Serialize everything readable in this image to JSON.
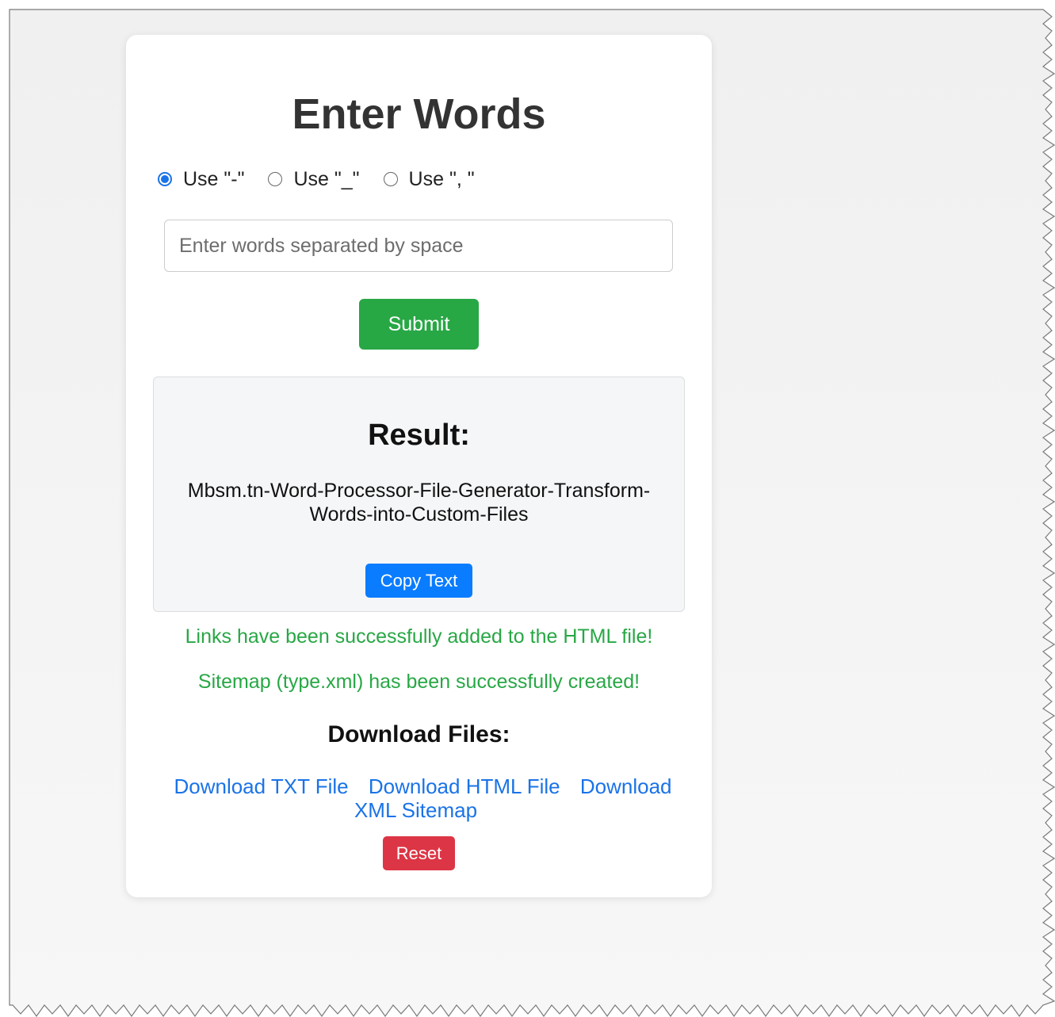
{
  "header": {
    "title": "Enter Words"
  },
  "separator_options": [
    {
      "label": "Use \"-\"",
      "checked": true
    },
    {
      "label": "Use \"_\"",
      "checked": false
    },
    {
      "label": "Use \", \"",
      "checked": false
    }
  ],
  "input": {
    "value": "",
    "placeholder": "Enter words separated by space"
  },
  "submit_label": "Submit",
  "result": {
    "title": "Result:",
    "text": "Mbsm.tn-Word-Processor-File-Generator-Transform-Words-into-Custom-Files",
    "copy_label": "Copy Text"
  },
  "messages": {
    "links_added": "Links have been successfully added to the HTML file!",
    "sitemap_created": "Sitemap (type.xml) has been successfully created!"
  },
  "downloads": {
    "title": "Download Files:",
    "txt_label": "Download TXT File",
    "html_label": "Download HTML File",
    "xml_label": "Download XML Sitemap"
  },
  "reset_label": "Reset",
  "colors": {
    "page_background": "#f2f2f2",
    "success": "#28a745",
    "primary": "#0a7cff",
    "danger": "#dc3545",
    "link": "#1a73e8"
  }
}
